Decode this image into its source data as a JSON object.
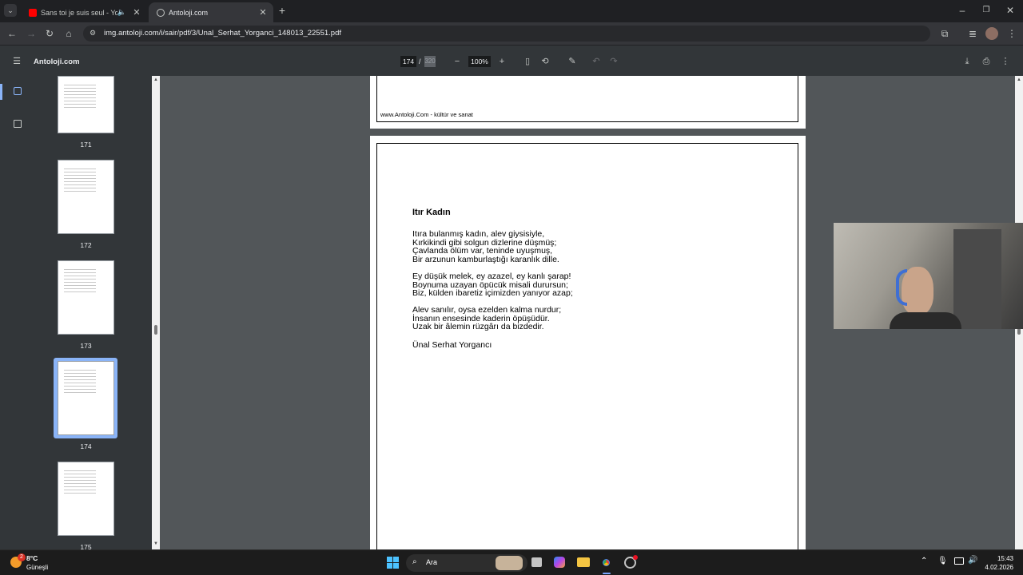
{
  "browser": {
    "tabs": [
      {
        "title": "Sans toi je suis seul - YouTu",
        "active": false
      },
      {
        "title": "Antoloji.com",
        "active": true
      }
    ],
    "new_tab_icon": "plus-icon",
    "url": "img.antoloji.com/i/sair/pdf/3/Unal_Serhat_Yorganci_148013_22551.pdf"
  },
  "pdf": {
    "title": "Antoloji.com",
    "current_page": "174",
    "separator": "/",
    "total_pages": "320",
    "zoom": "100%"
  },
  "thumbnails": [
    {
      "label": "171"
    },
    {
      "label": "172"
    },
    {
      "label": "173"
    },
    {
      "label": "174",
      "selected": true
    },
    {
      "label": "175"
    }
  ],
  "page_prev": {
    "footer": "www.Antoloji.Com - kültür ve sanat"
  },
  "poem": {
    "title": "Itır Kadın",
    "stanzas": [
      [
        "Itıra bulanmış kadın, alev giysisiyle,",
        "Kırkikindi gibi solgun dizlerine düşmüş;",
        "Çavlanda ölüm var, teninde uyuşmuş,",
        "Bir arzunun kamburlaştığı karanlık dille."
      ],
      [
        "Ey düşük melek, ey azazel, ey kanlı şarap!",
        "Boynuma uzayan öpücük misali durursun;",
        "Biz, külden ibaretiz içimizden yanıyor azap;"
      ],
      [
        "Alev sanılır, oysa ezelden kalma nurdur;",
        "İnsanın ensesinde kaderin öpüşüdür.",
        "Uzak bir âlemin rüzgârı da bizdedir."
      ]
    ],
    "author": "Ünal Serhat Yorgancı"
  },
  "taskbar": {
    "weather_temp": "8°C",
    "weather_condition": "Güneşli",
    "weather_badge": "2",
    "search_placeholder": "Ara",
    "time": "15:43",
    "date": "4.02.2026"
  },
  "colors": {
    "tab_active": "#35363a",
    "pdf_toolbar": "#323639",
    "doc_background": "#525659",
    "thumb_selected": "#8ab4f8",
    "youtube_red": "#ff0000"
  }
}
